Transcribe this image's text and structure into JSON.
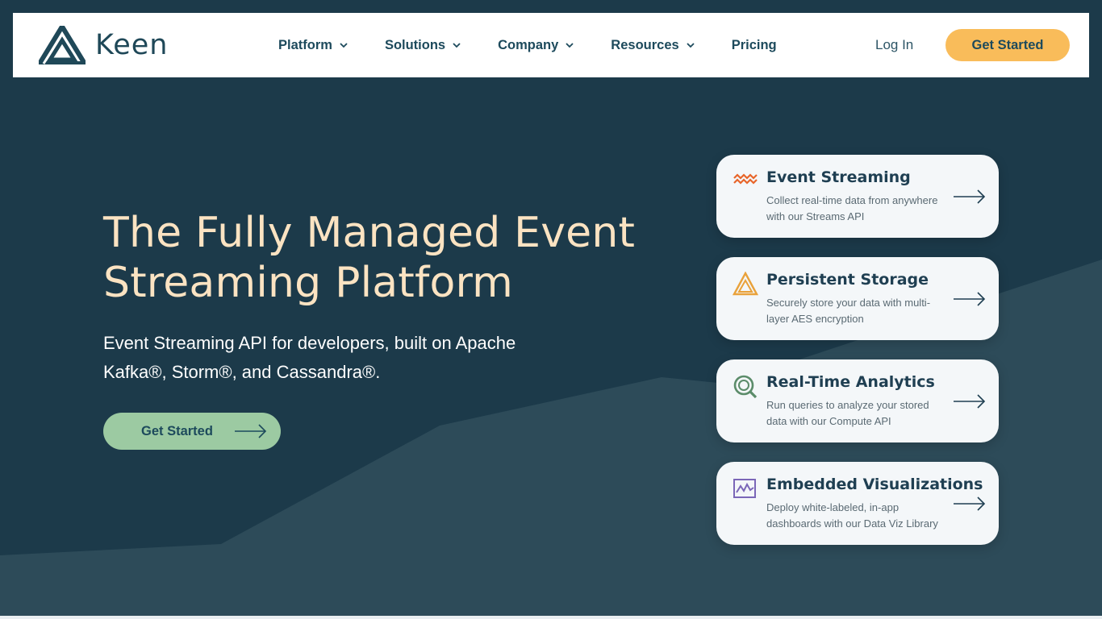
{
  "colors": {
    "page_bg": "#1c3a4a",
    "mountain": "#2d4b59",
    "nav_bg": "#ffffff",
    "brand_text": "#1f4858",
    "cta_yellow": "#f9bc5a",
    "hero_title": "#fbe3c2",
    "hero_cta_green": "#9ccaa2",
    "card_bg": "#f4f7f9"
  },
  "nav": {
    "logo_text": "Keen",
    "items": [
      {
        "label": "Platform",
        "dropdown": true
      },
      {
        "label": "Solutions",
        "dropdown": true
      },
      {
        "label": "Company",
        "dropdown": true
      },
      {
        "label": "Resources",
        "dropdown": true
      },
      {
        "label": "Pricing",
        "dropdown": false
      }
    ],
    "login_label": "Log In",
    "cta_label": "Get Started"
  },
  "hero": {
    "title": "The Fully Managed Event Streaming Platform",
    "subtitle": "Event Streaming API for developers, built on Apache Kafka®, Storm®, and Cassandra®.",
    "cta_label": "Get Started"
  },
  "features": [
    {
      "icon": "wave-icon",
      "icon_color": "#e8652a",
      "title": "Event Streaming",
      "description": "Collect real-time data from anywhere with our Streams API"
    },
    {
      "icon": "triangle-icon",
      "icon_color": "#e9a23b",
      "title": "Persistent Storage",
      "description": "Securely store your data with multi-layer AES encryption"
    },
    {
      "icon": "magnifier-icon",
      "icon_color": "#5b8c6a",
      "title": "Real-Time Analytics",
      "description": "Run queries to analyze your stored data with our Compute API"
    },
    {
      "icon": "line-chart-icon",
      "icon_color": "#7b67b8",
      "title": "Embedded Visualizations",
      "description": "Deploy white-labeled, in-app dashboards with our Data Viz Library"
    }
  ]
}
